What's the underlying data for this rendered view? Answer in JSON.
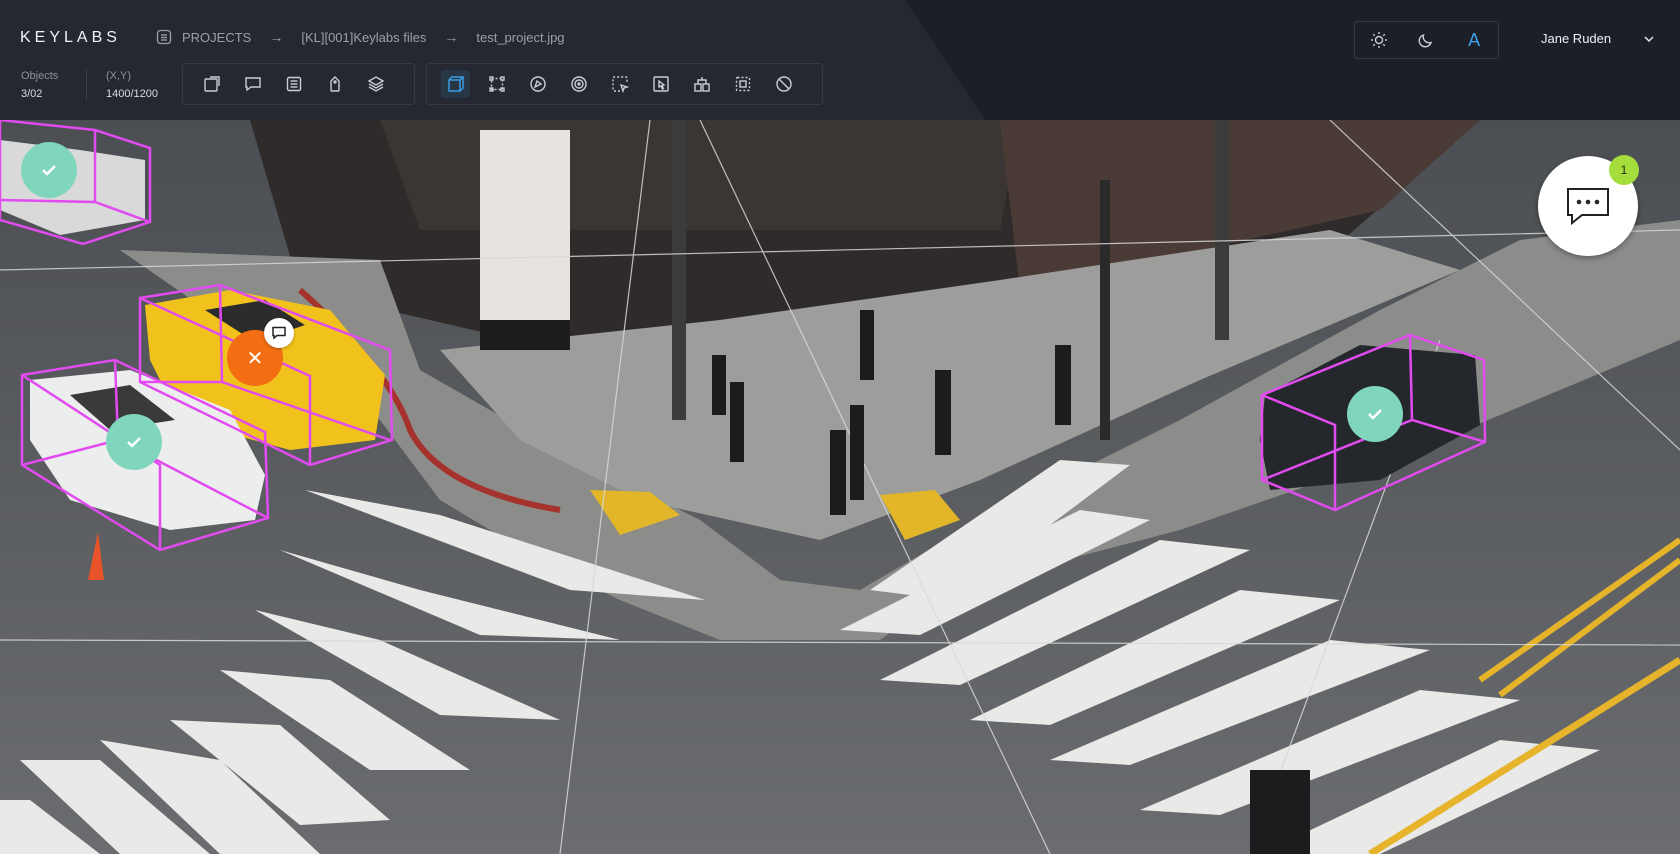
{
  "app": {
    "logo": "KEYLABS"
  },
  "breadcrumb": {
    "items": [
      "PROJECTS",
      "[KL][001]Keylabs files",
      "test_project.jpg"
    ],
    "separator": "→"
  },
  "stats": {
    "objects_label": "Objects",
    "objects_value": "3/02",
    "coords_label": "(X,Y)",
    "coords_value": "1400/1200"
  },
  "toolbar_left": {
    "tools": [
      "new-object-icon",
      "comment-icon",
      "list-icon",
      "tag-icon",
      "layers-icon"
    ]
  },
  "toolbar_right": {
    "tools": [
      "cuboid-icon",
      "bounding-box-icon",
      "polygon-icon",
      "ellipse-icon",
      "cursor-select-icon",
      "select-pointer-icon",
      "split-icon",
      "mask-icon",
      "no-entry-icon"
    ],
    "active": "cuboid-icon"
  },
  "themes": {
    "items": [
      "sun-icon",
      "moon-icon",
      "auto-theme-icon"
    ],
    "auto_label": "A",
    "active": "auto-theme-icon"
  },
  "user": {
    "name": "Jane Ruden"
  },
  "comments": {
    "count": "1"
  },
  "colors": {
    "accent": "#3aa2ea",
    "annotation": "#e14bf0",
    "approved": "#7fd6bd",
    "rejected": "#f36e13",
    "notification": "#a4dd3c"
  },
  "annotations": [
    {
      "label": "car",
      "status": "approved"
    },
    {
      "label": "taxi",
      "status": "rejected",
      "has_comment": true
    },
    {
      "label": "car",
      "status": "approved"
    },
    {
      "label": "car",
      "status": "approved"
    }
  ]
}
